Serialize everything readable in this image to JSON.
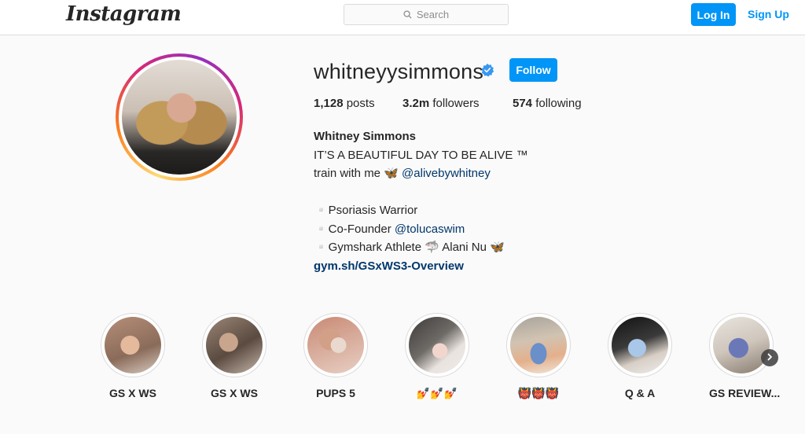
{
  "topbar": {
    "logo_text": "Instagram",
    "search_placeholder": "Search",
    "login_label": "Log In",
    "signup_label": "Sign Up"
  },
  "profile": {
    "username": "whitneyysimmons",
    "verified": true,
    "follow_label": "Follow",
    "stats": {
      "posts_count": "1,128",
      "posts_label": "posts",
      "followers_count": "3.2m",
      "followers_label": "followers",
      "following_count": "574",
      "following_label": "following"
    },
    "bio": {
      "full_name": "Whitney Simmons",
      "line1": "IT’S A BEAUTIFUL DAY TO BE ALIVE ™",
      "line2_prefix": "train with me 🦋 ",
      "line2_mention": "@alivebywhitney",
      "line3": "▫️Psoriasis Warrior",
      "line4_prefix": "▫️Co-Founder ",
      "line4_mention": "@tolucaswim",
      "line5": "▫️Gymshark Athlete 🦈 Alani Nu 🦋",
      "link": "gym.sh/GSxWS3-Overview"
    }
  },
  "highlights": [
    {
      "label": "GS X WS"
    },
    {
      "label": "GS X WS"
    },
    {
      "label": "PUPS 5"
    },
    {
      "label": "💅💅💅"
    },
    {
      "label": "👹👹👹"
    },
    {
      "label": "Q & A"
    },
    {
      "label": "GS REVIEW..."
    }
  ],
  "colors": {
    "accent": "#0095f6",
    "link": "#00376b",
    "verified_badge": "#3897f0",
    "background": "#fafafa",
    "border": "#dbdbdb"
  },
  "icons": {
    "search": "search-icon",
    "verified": "verified-badge-icon",
    "next": "chevron-right-icon"
  }
}
